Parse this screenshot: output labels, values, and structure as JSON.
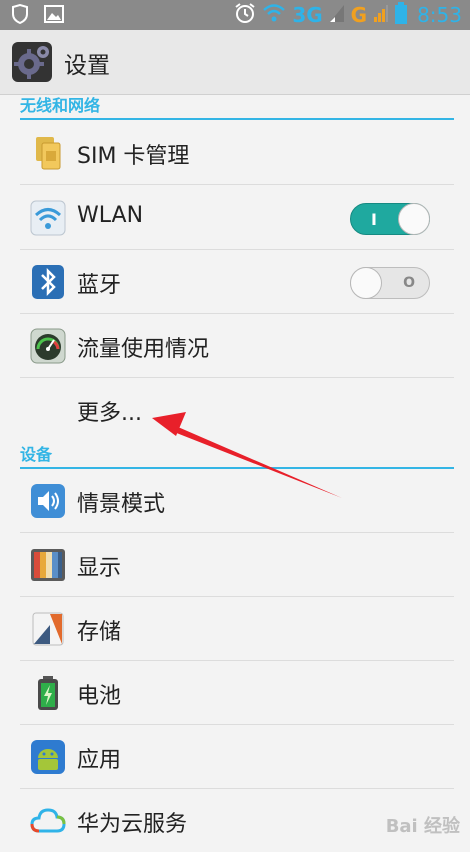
{
  "status_bar": {
    "network_3g": "3G",
    "network_g": "G",
    "time": "8:53"
  },
  "action_bar": {
    "title": "设置"
  },
  "sections": {
    "wireless": "无线和网络",
    "device": "设备"
  },
  "items": {
    "sim": "SIM 卡管理",
    "wlan": "WLAN",
    "bluetooth": "蓝牙",
    "data_usage": "流量使用情况",
    "more": "更多...",
    "profiles": "情景模式",
    "display": "显示",
    "storage": "存储",
    "battery": "电池",
    "apps": "应用",
    "huawei_cloud": "华为云服务"
  },
  "toggles": {
    "wlan": {
      "state": "on",
      "mark": "I"
    },
    "bluetooth": {
      "state": "off",
      "mark": "O"
    }
  },
  "watermark": "Bai 经验",
  "colors": {
    "accent": "#33b5e5",
    "toggle_on": "#1fa99f",
    "annotation": "#e8202a"
  }
}
